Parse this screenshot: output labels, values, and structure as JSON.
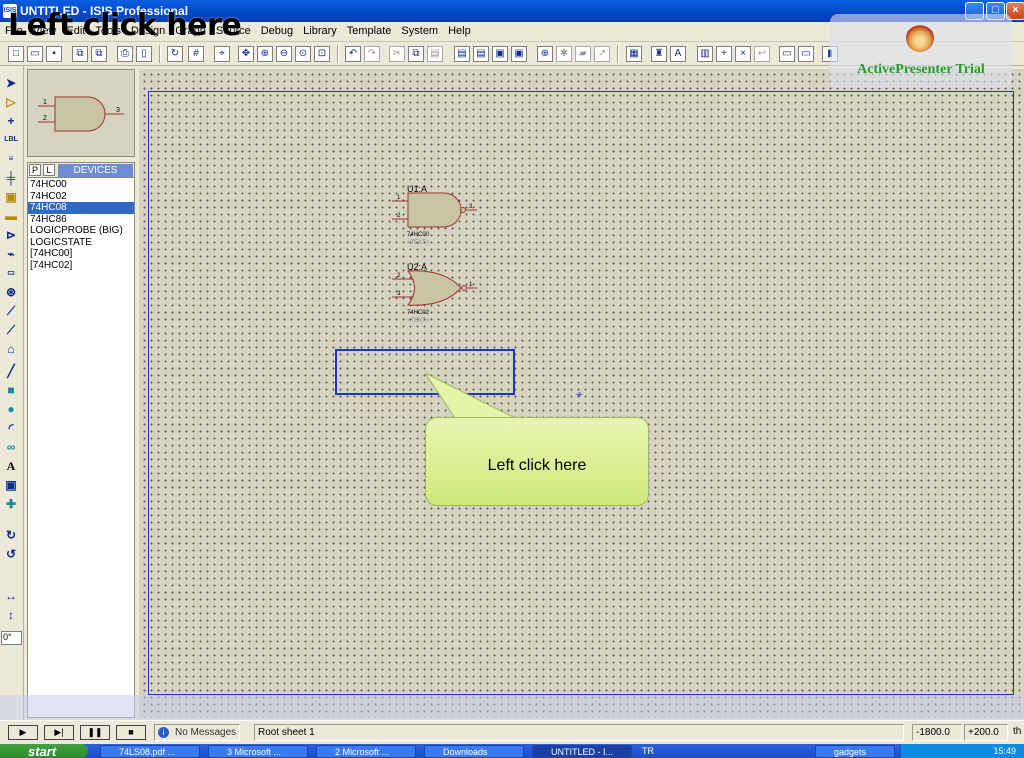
{
  "window": {
    "title": "UNTITLED - ISIS Professional",
    "app_icon": "ISIS"
  },
  "overlay_caption": "Left click here",
  "menu": [
    "File",
    "View",
    "Edit",
    "Tools",
    "Design",
    "Graph",
    "Source",
    "Debug",
    "Library",
    "Template",
    "System",
    "Help"
  ],
  "watermark": {
    "text": "ActivePresenter Trial"
  },
  "devices": {
    "tab_p": "P",
    "tab_l": "L",
    "title": "DEVICES",
    "items": [
      "74HC00",
      "74HC02",
      "74HC08",
      "74HC86",
      "LOGICPROBE (BIG)",
      "LOGICSTATE",
      "[74HC00]",
      "[74HC02]"
    ],
    "selected": "74HC08"
  },
  "preview": {
    "pin_a": "1",
    "pin_b": "2",
    "pin_out": "3"
  },
  "schematic": {
    "u1": {
      "ref": "U1:A",
      "part": "74HC00",
      "text": "<TEXT>",
      "pin_a": "1",
      "pin_b": "2",
      "pin_out": "3"
    },
    "u2": {
      "ref": "U2:A",
      "part": "74HC02",
      "text": "<TEXT>",
      "pin_a": "2",
      "pin_b": "3",
      "pin_out": "1"
    }
  },
  "callout": {
    "text": "Left click here"
  },
  "left_toolbar": {
    "angle": "0°"
  },
  "status": {
    "messages": "No Messages",
    "sheet": "Root sheet 1",
    "coord_x": "-1800.0",
    "coord_y": "+200.0",
    "unit": "th"
  },
  "taskbar": {
    "start": "start",
    "tasks": [
      "74LS08.pdf ...",
      "3 Microsoft ...",
      "2 Microsoft ...",
      "Downloads",
      "UNTITLED - I...",
      "gadgets"
    ],
    "tray_time": "15:49",
    "lang": "TR"
  },
  "colors": {
    "titlebar": "#0347C8",
    "canvas": "#D6D3C1",
    "sheet_border": "#1d37c8",
    "selected_row": "#316AC5",
    "gate_fill": "#C8C4A4",
    "gate_stroke": "#A0322A",
    "callout": "#DDF2A0"
  }
}
